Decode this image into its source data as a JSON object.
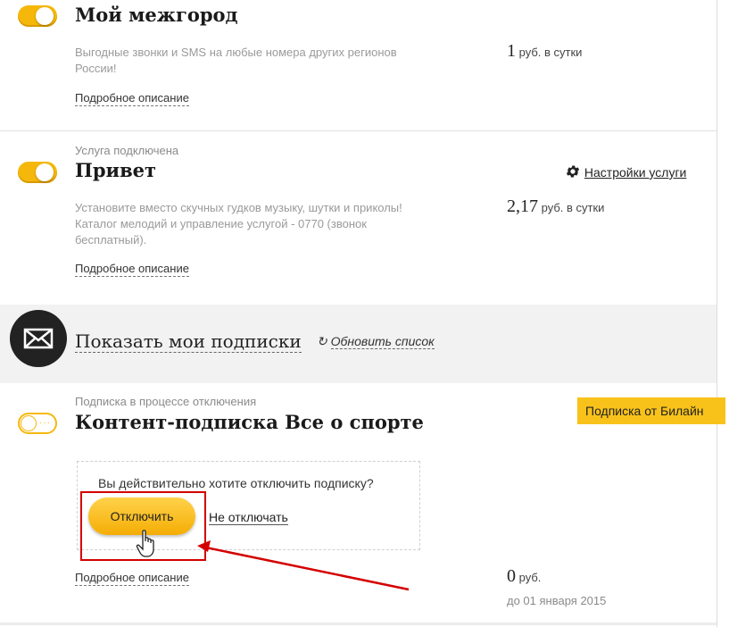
{
  "items": [
    {
      "title": "Мой межгород",
      "description": "Выгодные звонки и SMS на любые номера других регионов России!",
      "more_link": "Подробное описание",
      "price_value": "1",
      "price_unit": "руб. в сутки"
    },
    {
      "status": "Услуга подключена",
      "title": "Привет",
      "settings_label": "Настройки услуги",
      "description": "Установите вместо скучных гудков музыку, шутки и приколы! Каталог мелодий и управление услугой - 0770 (звонок бесплатный).",
      "more_link": "Подробное описание",
      "price_value": "2,17",
      "price_unit": "руб. в сутки"
    }
  ],
  "subscriptions": {
    "title": "Показать мои подписки",
    "refresh_label": "Обновить список"
  },
  "subscription_item": {
    "status": "Подписка в процессе отключения",
    "title": "Контент-подписка Все о спорте",
    "badge": "Подписка от Билайн",
    "confirm_question": "Вы действительно хотите отключить подписку?",
    "confirm_button": "Отключить",
    "cancel_link": "Не отключать",
    "more_link": "Подробное описание",
    "price_value": "0",
    "price_unit": "руб.",
    "price_until": "до 01 января 2015"
  },
  "colors": {
    "accent": "#f5b80a",
    "annotation": "#d40000"
  }
}
